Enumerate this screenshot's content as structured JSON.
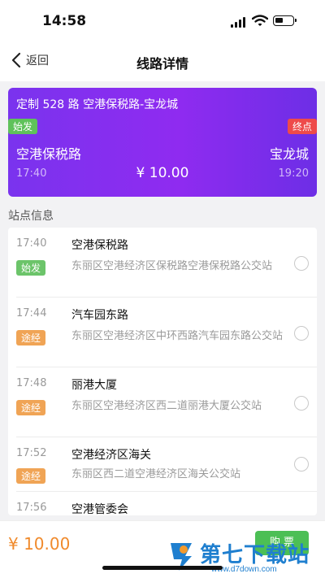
{
  "status_bar": {
    "time": "14:58"
  },
  "nav": {
    "back_label": "返回",
    "title": "线路详情"
  },
  "route": {
    "name": "定制 528 路 空港保税路-宝龙城",
    "start_badge": "始发",
    "end_badge": "终点",
    "from": "空港保税路",
    "to": "宝龙城",
    "depart_time": "17:40",
    "arrive_time": "19:20",
    "price": "¥ 10.00"
  },
  "section": {
    "title": "站点信息"
  },
  "stops": [
    {
      "time": "17:40",
      "name": "空港保税路",
      "badge": "始发",
      "badge_type": "start",
      "address": "东丽区空港经济区保税路空港保税路公交站"
    },
    {
      "time": "17:44",
      "name": "汽车园东路",
      "badge": "途经",
      "badge_type": "via",
      "address": "东丽区空港经济区中环西路汽车园东路公交站"
    },
    {
      "time": "17:48",
      "name": "丽港大厦",
      "badge": "途经",
      "badge_type": "via",
      "address": "东丽区空港经济区西二道丽港大厦公交站"
    },
    {
      "time": "17:52",
      "name": "空港经济区海关",
      "badge": "途经",
      "badge_type": "via",
      "address": "东丽区西二道空港经济区海关公交站"
    },
    {
      "time": "17:56",
      "name": "空港管委会",
      "badge": "",
      "badge_type": "via",
      "address": ""
    }
  ],
  "bottom": {
    "total": "¥ 10.00",
    "buy_label": "购 票"
  },
  "watermark": {
    "text": "第七下载站",
    "url": "www.d7down.com"
  },
  "colors": {
    "accent": "#8f2bf0",
    "start_green": "#6cc46a",
    "via_orange": "#f0a455",
    "end_red": "#ee4a4a",
    "price_orange": "#f08a2c",
    "buy_green": "#4cbf55"
  },
  "icons": {
    "back": "chevron-left-icon",
    "signal": "cellular-signal-icon",
    "wifi": "wifi-icon",
    "battery": "battery-icon",
    "radio": "radio-unchecked-icon"
  }
}
